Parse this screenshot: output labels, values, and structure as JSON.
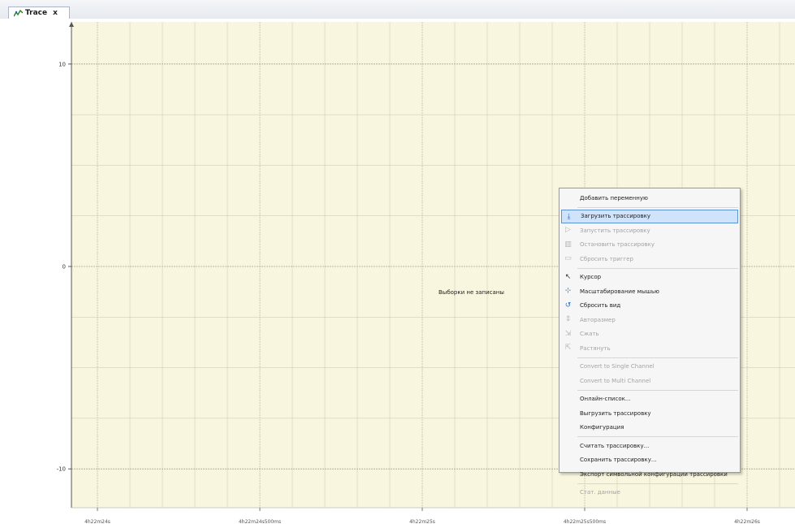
{
  "tab": {
    "title": "Trace",
    "close_symbol": "x"
  },
  "plot": {
    "empty_message": "Выборки не записаны",
    "y_ticks": [
      {
        "label": "10",
        "value": 10
      },
      {
        "label": "0",
        "value": 0
      },
      {
        "label": "-10",
        "value": -10
      }
    ],
    "x_tick_labels": [
      "4h22m24s",
      "4h22m24s500ms",
      "4h22m25s",
      "4h22m25s500ms",
      "4h22m26s"
    ],
    "colors": {
      "background": "#f8f6de",
      "grid": "#c9c7b0",
      "axis": "#555555"
    }
  },
  "context_menu": {
    "groups": [
      [
        {
          "label": "Добавить переменную",
          "enabled": true,
          "icon": ""
        }
      ],
      [
        {
          "label": "Загрузить трассировку",
          "enabled": true,
          "icon": "download-trace-icon",
          "highlighted": true
        },
        {
          "label": "Запустить трассировку",
          "enabled": false,
          "icon": "play-icon"
        },
        {
          "label": "Остановить трассировку",
          "enabled": false,
          "icon": "stop-icon"
        },
        {
          "label": "Сбросить триггер",
          "enabled": false,
          "icon": "reset-trigger-icon"
        }
      ],
      [
        {
          "label": "Курсор",
          "enabled": true,
          "icon": "cursor-icon"
        },
        {
          "label": "Масштабирование мышью",
          "enabled": true,
          "icon": "mouse-zoom-icon"
        },
        {
          "label": "Сбросить вид",
          "enabled": true,
          "icon": "reset-view-icon"
        },
        {
          "label": "Авторазмер",
          "enabled": false,
          "icon": "autosize-icon"
        },
        {
          "label": "Сжать",
          "enabled": false,
          "icon": "compress-icon"
        },
        {
          "label": "Растянуть",
          "enabled": false,
          "icon": "stretch-icon"
        }
      ],
      [
        {
          "label": "Convert to Single Channel",
          "enabled": false,
          "icon": ""
        },
        {
          "label": "Convert to Multi Channel",
          "enabled": false,
          "icon": ""
        }
      ],
      [
        {
          "label": "Онлайн-список...",
          "enabled": true,
          "icon": ""
        },
        {
          "label": "Выгрузить трассировку",
          "enabled": true,
          "icon": ""
        },
        {
          "label": "Конфигурация",
          "enabled": true,
          "icon": ""
        }
      ],
      [
        {
          "label": "Считать трассировку...",
          "enabled": true,
          "icon": ""
        },
        {
          "label": "Сохранить трассировку...",
          "enabled": true,
          "icon": ""
        },
        {
          "label": "Экспорт символьной конфигурации трассировки",
          "enabled": true,
          "icon": ""
        }
      ],
      [
        {
          "label": "Стат. данные",
          "enabled": false,
          "icon": ""
        }
      ]
    ]
  }
}
